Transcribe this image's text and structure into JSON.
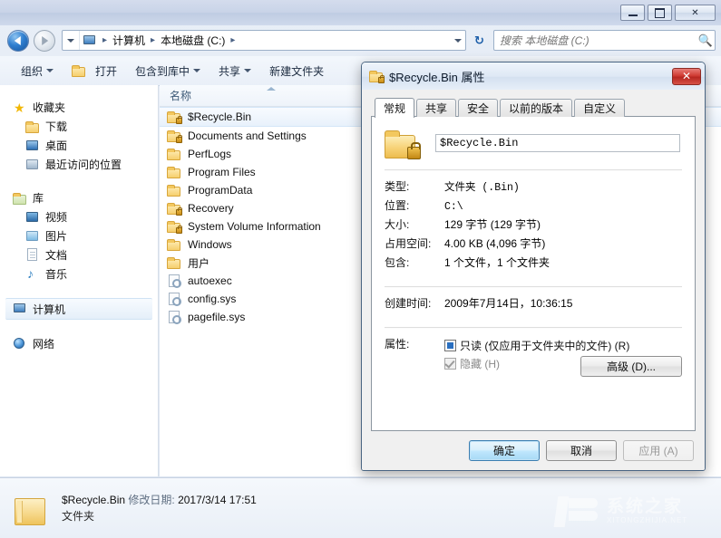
{
  "window": {
    "minimize_label": "最小化",
    "maximize_label": "最大化",
    "close_label": "✕"
  },
  "address": {
    "crumbs": [
      "计算机",
      "本地磁盘 (C:)"
    ],
    "separator": "▸",
    "computer_icon": "computer-icon"
  },
  "search": {
    "placeholder": "搜索 本地磁盘 (C:)",
    "icon": "search-icon"
  },
  "refresh": {
    "glyph": "↻"
  },
  "toolbar": {
    "items": [
      {
        "label": "组织",
        "caret": "▾",
        "icon": null
      },
      {
        "label": "打开",
        "caret": "",
        "icon": "open-folder-icon"
      },
      {
        "label": "包含到库中",
        "caret": "▾",
        "icon": null
      },
      {
        "label": "共享",
        "caret": "▾",
        "icon": null
      },
      {
        "label": "新建文件夹",
        "caret": "",
        "icon": null
      }
    ]
  },
  "navpane": {
    "groups": [
      {
        "header": {
          "label": "收藏夹",
          "icon": "star-icon"
        },
        "items": [
          {
            "label": "下载",
            "icon": "download-folder-icon"
          },
          {
            "label": "桌面",
            "icon": "desktop-icon"
          },
          {
            "label": "最近访问的位置",
            "icon": "recent-places-icon"
          }
        ]
      },
      {
        "header": {
          "label": "库",
          "icon": "library-icon"
        },
        "items": [
          {
            "label": "视频",
            "icon": "video-icon"
          },
          {
            "label": "图片",
            "icon": "picture-icon"
          },
          {
            "label": "文档",
            "icon": "document-icon"
          },
          {
            "label": "音乐",
            "icon": "music-icon"
          }
        ]
      },
      {
        "header": {
          "label": "计算机",
          "icon": "computer-icon",
          "selected": true
        },
        "items": []
      },
      {
        "header": {
          "label": "网络",
          "icon": "network-icon"
        },
        "items": []
      }
    ]
  },
  "filelist": {
    "column_header": "名称",
    "sort_direction": "asc",
    "rows": [
      {
        "name": "$Recycle.Bin",
        "icon": "locked-folder-icon",
        "selected": true
      },
      {
        "name": "Documents and Settings",
        "icon": "locked-folder-icon",
        "selected": false
      },
      {
        "name": "PerfLogs",
        "icon": "folder-icon",
        "selected": false
      },
      {
        "name": "Program Files",
        "icon": "folder-icon",
        "selected": false
      },
      {
        "name": "ProgramData",
        "icon": "folder-icon",
        "selected": false
      },
      {
        "name": "Recovery",
        "icon": "locked-folder-icon",
        "selected": false
      },
      {
        "name": "System Volume Information",
        "icon": "locked-folder-icon",
        "selected": false
      },
      {
        "name": "Windows",
        "icon": "folder-icon",
        "selected": false
      },
      {
        "name": "用户",
        "icon": "folder-icon",
        "selected": false
      },
      {
        "name": "autoexec",
        "icon": "system-file-icon",
        "selected": false
      },
      {
        "name": "config.sys",
        "icon": "system-file-icon",
        "selected": false
      },
      {
        "name": "pagefile.sys",
        "icon": "system-file-icon",
        "selected": false
      }
    ]
  },
  "details": {
    "name": "$Recycle.Bin",
    "modified_label": "修改日期:",
    "modified_value": "2017/3/14 17:51",
    "type": "文件夹",
    "icon": "folder-icon"
  },
  "watermark": {
    "cn": "系统之家",
    "en": "XITONGZHIJIA.NET"
  },
  "dialog": {
    "title": "$Recycle.Bin 属性",
    "title_icon": "locked-folder-icon",
    "close_label": "✕",
    "tabs": [
      {
        "label": "常规",
        "active": true
      },
      {
        "label": "共享",
        "active": false
      },
      {
        "label": "安全",
        "active": false
      },
      {
        "label": "以前的版本",
        "active": false
      },
      {
        "label": "自定义",
        "active": false
      }
    ],
    "name_value": "$Recycle.Bin",
    "properties": [
      {
        "label": "类型:",
        "value": "文件夹 (.Bin)"
      },
      {
        "label": "位置:",
        "value": "C:\\"
      },
      {
        "label": "大小:",
        "value": "129 字节 (129 字节)"
      },
      {
        "label": "占用空间:",
        "value": "4.00 KB (4,096 字节)"
      },
      {
        "label": "包含:",
        "value": "1 个文件，1 个文件夹"
      }
    ],
    "created": {
      "label": "创建时间:",
      "value": "2009年7月14日，10:36:15"
    },
    "attributes": {
      "label": "属性:",
      "readonly": {
        "label": "只读 (仅应用于文件夹中的文件) (R)",
        "state": "indeterminate"
      },
      "hidden": {
        "label": "隐藏 (H)",
        "state": "checked-disabled"
      },
      "advanced_button": "高级 (D)..."
    },
    "buttons": {
      "ok": "确定",
      "cancel": "取消",
      "apply": "应用 (A)"
    }
  }
}
